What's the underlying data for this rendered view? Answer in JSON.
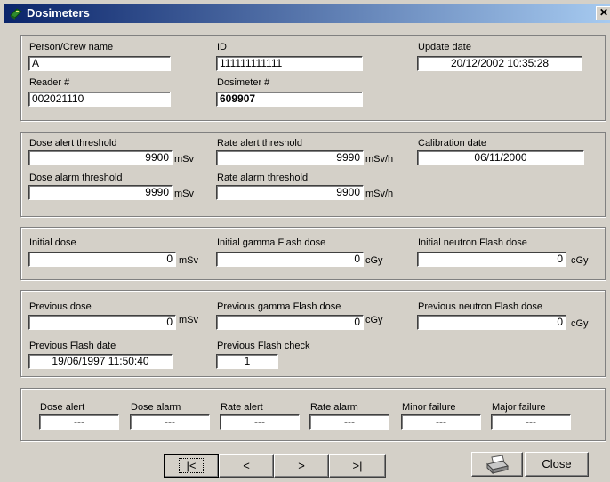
{
  "window": {
    "title": "Dosimeters",
    "close_glyph": "✕"
  },
  "identity": {
    "person_label": "Person/Crew name",
    "person_value": "A",
    "id_label": "ID",
    "id_value": "111111111111",
    "update_label": "Update date",
    "update_value": "20/12/2002 10:35:28",
    "reader_label": "Reader #",
    "reader_value": "002021110",
    "dosimeter_label": "Dosimeter #",
    "dosimeter_value": "609907"
  },
  "thresholds": {
    "dose_alert_label": "Dose alert threshold",
    "dose_alert_value": "9900",
    "dose_alert_unit": "mSv",
    "rate_alert_label": "Rate alert threshold",
    "rate_alert_value": "9990",
    "rate_alert_unit": "mSv/h",
    "calibration_label": "Calibration date",
    "calibration_value": "06/11/2000",
    "dose_alarm_label": "Dose alarm threshold",
    "dose_alarm_value": "9990",
    "dose_alarm_unit": "mSv",
    "rate_alarm_label": "Rate alarm threshold",
    "rate_alarm_value": "9900",
    "rate_alarm_unit": "mSv/h"
  },
  "initial": {
    "dose_label": "Initial dose",
    "dose_value": "0",
    "dose_unit": "mSv",
    "gamma_label": "Initial gamma Flash dose",
    "gamma_value": "0",
    "gamma_unit": "cGy",
    "neutron_label": "Initial neutron Flash dose",
    "neutron_value": "0",
    "neutron_unit": "cGy"
  },
  "previous": {
    "dose_label": "Previous dose",
    "dose_value": "0",
    "dose_unit": "mSv",
    "gamma_label": "Previous gamma Flash dose",
    "gamma_value": "0",
    "gamma_unit": "cGy",
    "neutron_label": "Previous neutron Flash dose",
    "neutron_value": "0",
    "neutron_unit": "cGy",
    "flash_date_label": "Previous Flash date",
    "flash_date_value": "19/06/1997 11:50:40",
    "flash_check_label": "Previous Flash check",
    "flash_check_value": "1"
  },
  "status": {
    "dose_alert_label": "Dose alert",
    "dose_alert_value": "---",
    "dose_alarm_label": "Dose alarm",
    "dose_alarm_value": "---",
    "rate_alert_label": "Rate alert",
    "rate_alert_value": "---",
    "rate_alarm_label": "Rate alarm",
    "rate_alarm_value": "---",
    "minor_label": "Minor failure",
    "minor_value": "---",
    "major_label": "Major failure",
    "major_value": "---"
  },
  "nav": {
    "first": "|<",
    "prev": "<",
    "next": ">",
    "last": ">|"
  },
  "buttons": {
    "close_label": "Close",
    "print_icon": "printer-icon"
  }
}
